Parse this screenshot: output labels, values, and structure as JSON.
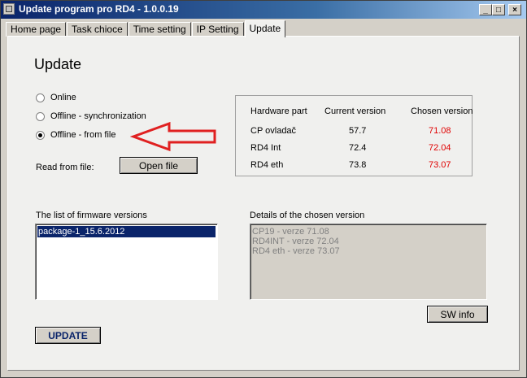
{
  "window": {
    "title": "Update program pro RD4 - 1.0.0.19",
    "minimize": "_",
    "maximize": "□",
    "close": "×"
  },
  "tabs": [
    {
      "label": "Home page"
    },
    {
      "label": "Task chioce"
    },
    {
      "label": "Time setting"
    },
    {
      "label": "IP Setting"
    },
    {
      "label": "Update",
      "active": true
    }
  ],
  "update": {
    "heading": "Update",
    "options": [
      {
        "label": "Online",
        "checked": false
      },
      {
        "label": "Offline - synchronization",
        "checked": false
      },
      {
        "label": "Offline - from file",
        "checked": true
      }
    ],
    "read_from_file_label": "Read from file:",
    "open_file_button": "Open file",
    "versions_table": {
      "headers": [
        "Hardware part",
        "Current version",
        "Chosen version"
      ],
      "rows": [
        {
          "part": "CP ovladač",
          "current": "57.7",
          "chosen": "71.08"
        },
        {
          "part": "RD4 Int",
          "current": "72.4",
          "chosen": "72.04"
        },
        {
          "part": "RD4 eth",
          "current": "73.8",
          "chosen": "73.07"
        }
      ]
    },
    "firmware_list_label": "The list of firmware versions",
    "firmware_list": [
      "package-1_15.6.2012"
    ],
    "details_label": "Details of the chosen version",
    "details_lines": [
      "CP19 - verze 71.08",
      "RD4INT - verze 72.04",
      "RD4 eth - verze 73.07"
    ],
    "sw_info_button": "SW info",
    "update_button": "UPDATE"
  },
  "colors": {
    "titlebar_start": "#0a246a",
    "selection": "#0a246a",
    "chosen_version_text": "#e00000",
    "annotation_arrow": "#e02020"
  },
  "annotation": {
    "icon": "arrow-left-icon"
  }
}
